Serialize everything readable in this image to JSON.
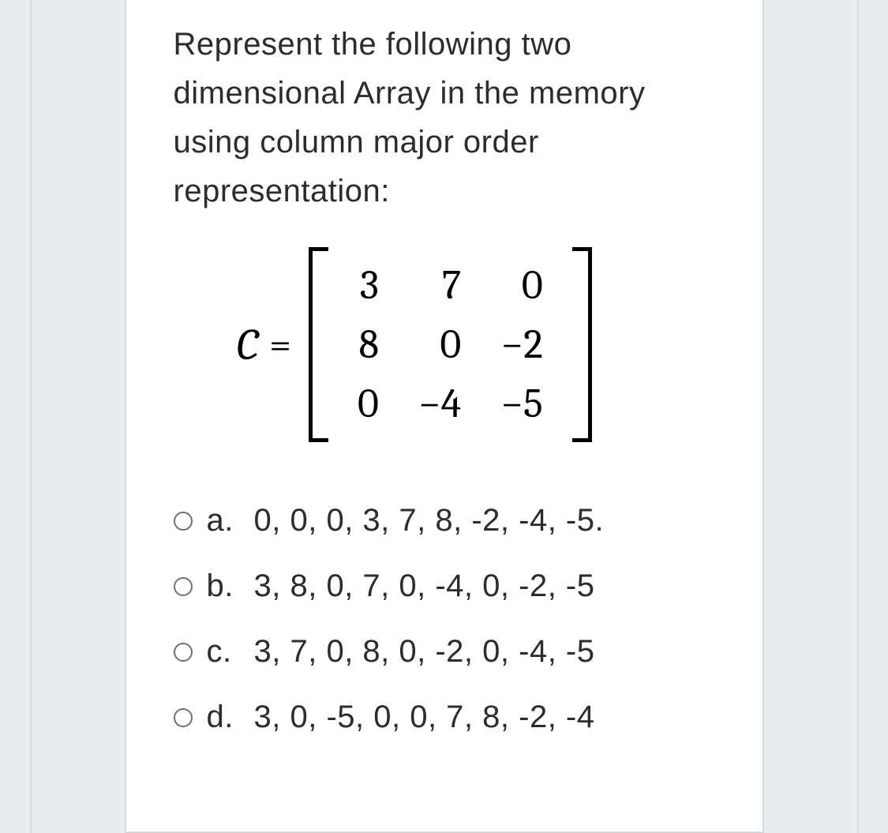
{
  "question": {
    "text": "Represent the following two dimensional Array in the memory using column major order representation:",
    "matrix": {
      "name": "C",
      "equals": "=",
      "rows": [
        [
          "3",
          "7",
          "0"
        ],
        [
          "8",
          "0",
          "−2"
        ],
        [
          "0",
          "−4",
          "−5"
        ]
      ]
    },
    "options": [
      {
        "letter": "a.",
        "text": "0, 0, 0, 3, 7, 8, -2, -4, -5."
      },
      {
        "letter": "b.",
        "text": "3, 8, 0, 7, 0, -4, 0, -2, -5"
      },
      {
        "letter": "c.",
        "text": "3, 7, 0, 8, 0, -2, 0, -4, -5"
      },
      {
        "letter": "d.",
        "text": "3, 0, -5, 0, 0, 7, 8, -2, -4"
      }
    ]
  }
}
